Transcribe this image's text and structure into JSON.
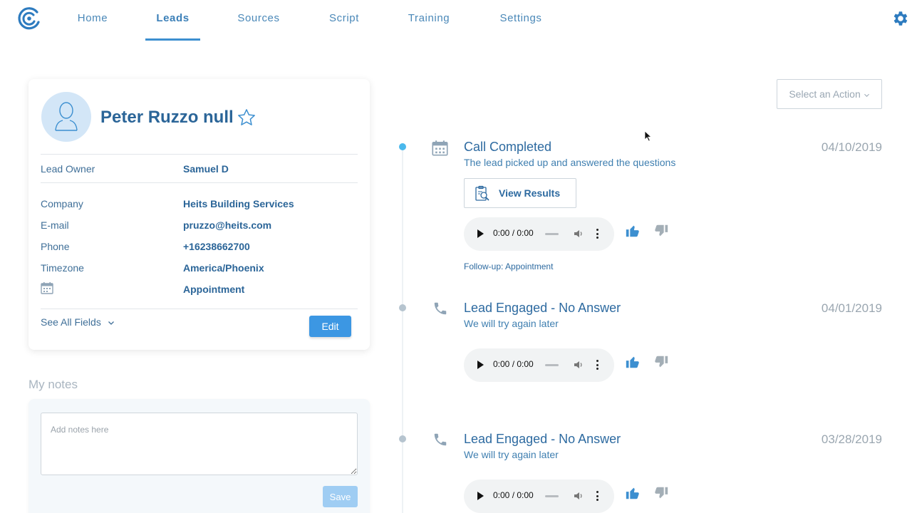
{
  "nav": {
    "tabs": [
      {
        "label": "Home"
      },
      {
        "label": "Leads",
        "active": true
      },
      {
        "label": "Sources"
      },
      {
        "label": "Script"
      },
      {
        "label": "Training"
      },
      {
        "label": "Settings"
      }
    ]
  },
  "colors": {
    "brand": "#2d6aa0",
    "accent": "#3c97e3",
    "timeline_active_dot": "#4ab8ec",
    "timeline_dot": "#b6c4cf",
    "thumb_up": "#3c8fd0",
    "thumb_down": "#a3aeb6"
  },
  "lead": {
    "name": "Peter Ruzzo null",
    "owner_label": "Lead Owner",
    "owner_value": "Samuel D",
    "fields": [
      {
        "label": "Company",
        "value": "Heits Building Services"
      },
      {
        "label": "E-mail",
        "value": "pruzzo@heits.com"
      },
      {
        "label": "Phone",
        "value": "+16238662700"
      },
      {
        "label": "Timezone",
        "value": "America/Phoenix"
      }
    ],
    "appointment_value": "Appointment",
    "see_all_label": "See All Fields",
    "edit_label": "Edit"
  },
  "notes": {
    "title": "My notes",
    "placeholder": "Add notes here",
    "save_label": "Save"
  },
  "actions": {
    "select_label": "Select an Action"
  },
  "timeline": [
    {
      "title": "Call Completed",
      "subtitle": "The lead picked up and answered the questions",
      "date": "04/10/2019",
      "icon": "calendar-icon",
      "view_results_label": "View Results",
      "audio_time": "0:00 / 0:00",
      "followup": "Follow-up: Appointment"
    },
    {
      "title": "Lead Engaged - No Answer",
      "subtitle": "We will try again later",
      "date": "04/01/2019",
      "icon": "phone-icon",
      "audio_time": "0:00 / 0:00"
    },
    {
      "title": "Lead Engaged - No Answer",
      "subtitle": "We will try again later",
      "date": "03/28/2019",
      "icon": "phone-icon",
      "audio_time": "0:00 / 0:00"
    }
  ]
}
